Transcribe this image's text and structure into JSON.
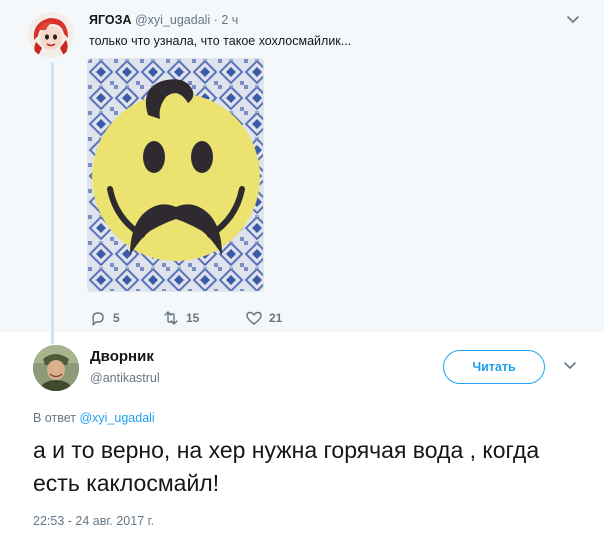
{
  "parent_tweet": {
    "display_name": "ЯГОЗА",
    "handle": "@xyi_ugadali",
    "separator": "·",
    "time": "2 ч",
    "text": "только что узнала, что такое хохлосмайлик...",
    "image_icon": "smiley-with-mustache-image",
    "stats": {
      "replies": "5",
      "retweets": "15",
      "likes": "21"
    }
  },
  "reply_tweet": {
    "display_name": "Дворник",
    "handle": "@antikastrul",
    "follow_label": "Читать",
    "reply_to_prefix": "В ответ",
    "reply_to_handle": "@xyi_ugadali",
    "text": "а и то верно, на хер нужна горячая вода , когда есть каклосмайл!",
    "timestamp": "22:53 - 24 авг. 2017 г."
  },
  "colors": {
    "accent": "#1da1f2",
    "muted": "#657786",
    "parent_bg": "#f5f8fa",
    "thread_line": "#cfe3f4"
  }
}
